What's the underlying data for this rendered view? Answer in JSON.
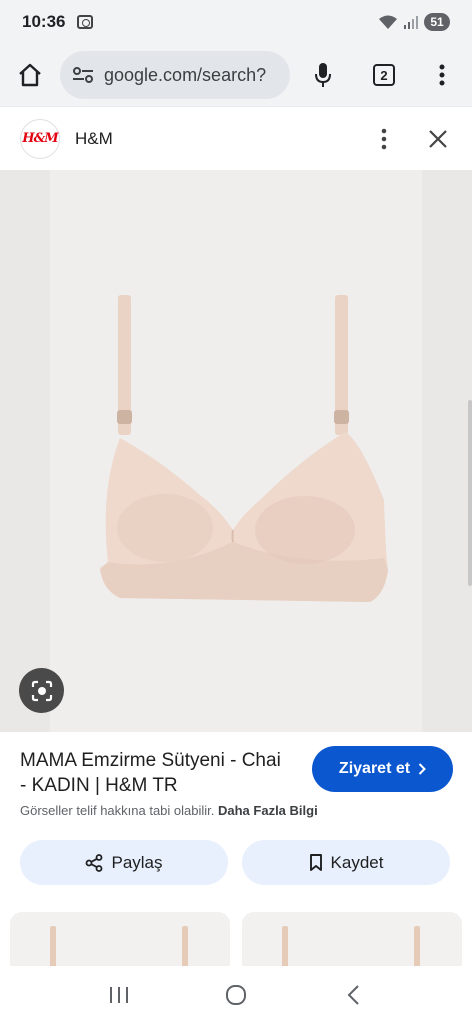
{
  "status": {
    "time": "10:36",
    "battery": "51"
  },
  "browser": {
    "url": "google.com/search?",
    "tab_count": "2"
  },
  "source": {
    "name": "H&M",
    "logo_text": "H&M"
  },
  "product": {
    "title": "MAMA Emzirme Sütyeni - Chai - KADIN | H&M TR",
    "visit_label": "Ziyaret et",
    "copyright_text": "Görseller telif hakkına tabi olabilir.",
    "more_info_label": "Daha Fazla Bilgi"
  },
  "actions": {
    "share_label": "Paylaş",
    "save_label": "Kaydet"
  },
  "colors": {
    "accent": "#0b57d0",
    "chip_bg": "#e8f0fe",
    "product_tone": "#eed9cc"
  },
  "icons": [
    "home-icon",
    "tune-icon",
    "mic-icon",
    "more-vert-icon",
    "close-icon",
    "lens-icon",
    "share-icon",
    "bookmark-icon",
    "chevron-right-icon",
    "recents-icon",
    "home-circle-icon",
    "back-icon"
  ]
}
